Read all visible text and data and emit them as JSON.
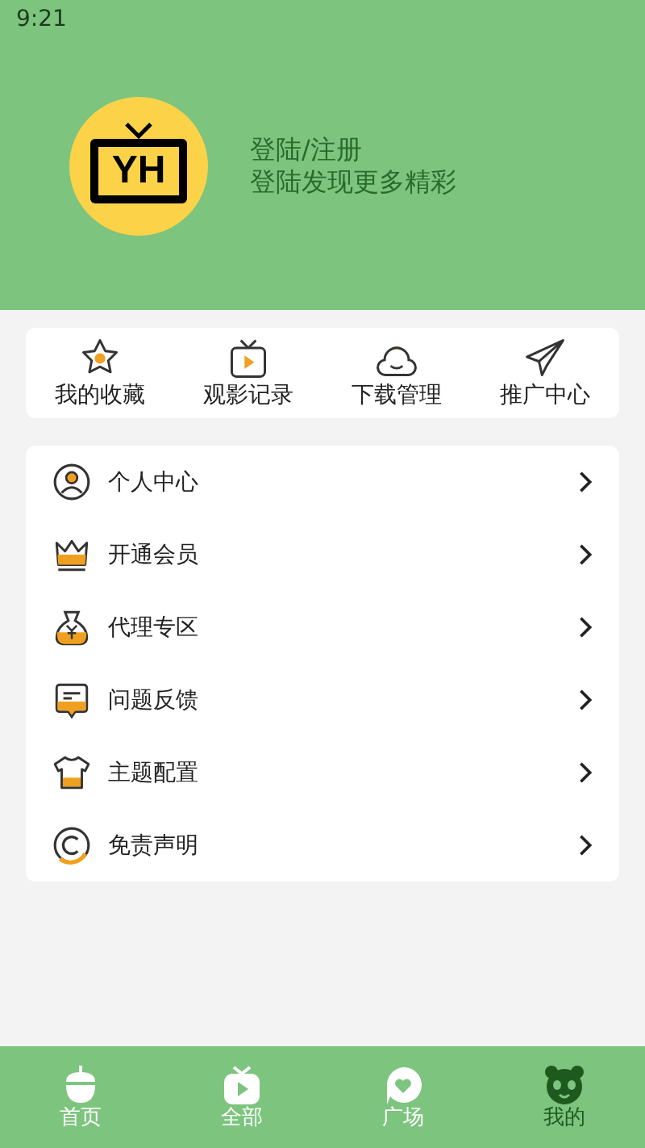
{
  "status_bar": {
    "time": "9:21"
  },
  "profile": {
    "logo_text": "YH",
    "title": "登陆/注册",
    "subtitle": "登陆发现更多精彩"
  },
  "quick_actions": [
    {
      "kind": "star",
      "label": "我的收藏"
    },
    {
      "kind": "tv",
      "label": "观影记录"
    },
    {
      "kind": "cloud",
      "label": "下载管理"
    },
    {
      "kind": "plane",
      "label": "推广中心"
    }
  ],
  "menu": [
    {
      "kind": "person",
      "label": "个人中心"
    },
    {
      "kind": "crown",
      "label": "开通会员"
    },
    {
      "kind": "bag",
      "label": "代理专区"
    },
    {
      "kind": "message",
      "label": "问题反馈"
    },
    {
      "kind": "shirt",
      "label": "主题配置"
    },
    {
      "kind": "copyright",
      "label": "免责声明"
    }
  ],
  "bottom_nav": [
    {
      "kind": "acorn",
      "label": "首页",
      "selected": false
    },
    {
      "kind": "tv",
      "label": "全部",
      "selected": false
    },
    {
      "kind": "chat",
      "label": "广场",
      "selected": false
    },
    {
      "kind": "panda",
      "label": "我的",
      "selected": true
    }
  ]
}
